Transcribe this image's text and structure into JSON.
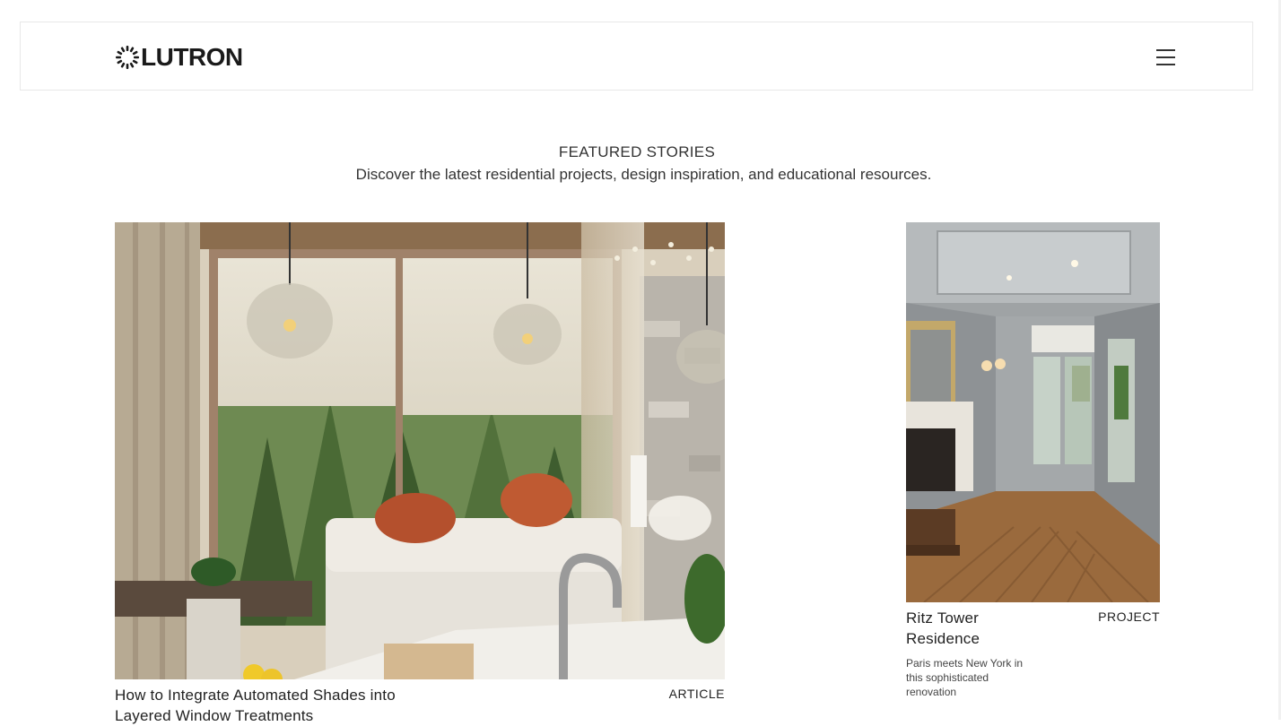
{
  "header": {
    "brand": "LUTRON",
    "menu_icon": "hamburger-menu-icon"
  },
  "featured": {
    "eyebrow": "FEATURED STORIES",
    "subtitle": "Discover the latest residential projects, design inspiration, and educational resources."
  },
  "cards": [
    {
      "title": "How to Integrate Automated Shades into Layered Window Treatments",
      "type": "ARTICLE",
      "image": "living-room-with-automated-shades-image"
    },
    {
      "title": "Ritz Tower Residence",
      "type": "PROJECT",
      "description": "Paris meets New York in this sophisticated renovation",
      "image": "ritz-tower-interior-image"
    }
  ],
  "colors": {
    "text": "#222222",
    "border": "#e8e8e8",
    "background": "#ffffff"
  }
}
